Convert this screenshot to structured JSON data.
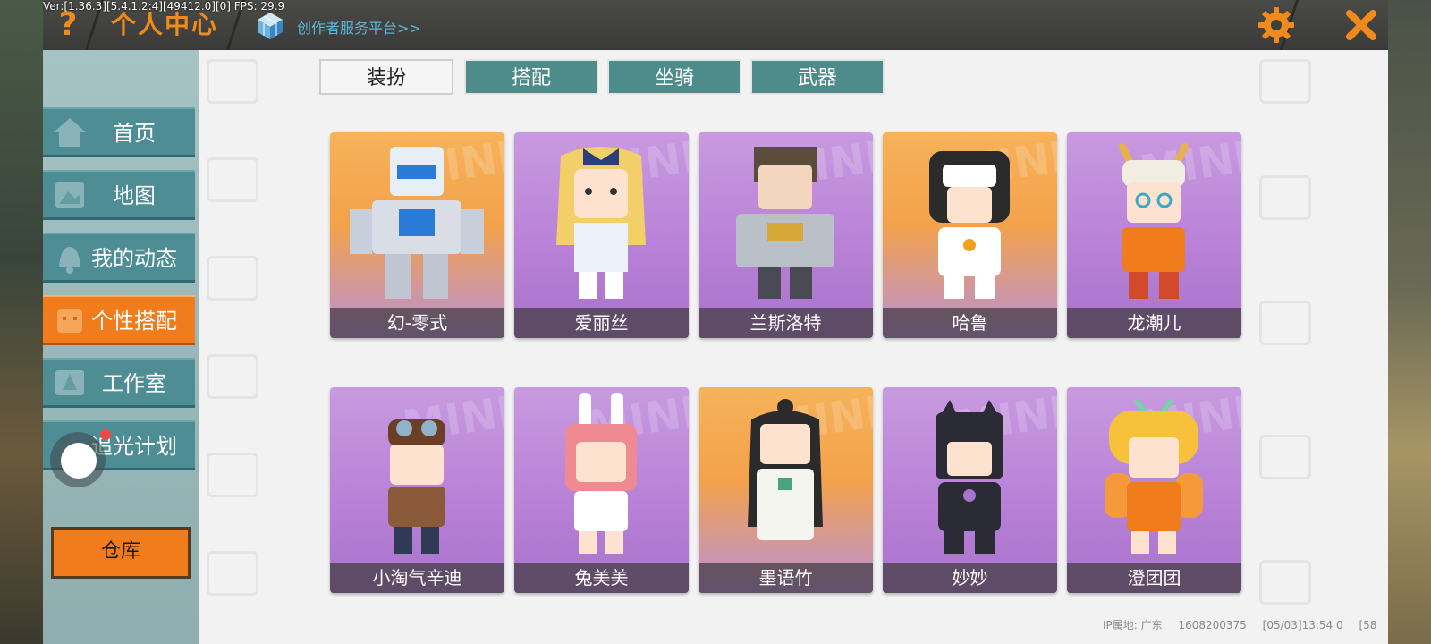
{
  "version_text": "Ver:[1.36.3][5.4.1.2:4][49412.0][0] FPS: 29.9",
  "header": {
    "title": "个人中心",
    "creator_link": "创作者服务平台>>"
  },
  "sidebar": {
    "items": [
      {
        "label": "首页",
        "active": false
      },
      {
        "label": "地图",
        "active": false
      },
      {
        "label": "我的动态",
        "active": false
      },
      {
        "label": "个性搭配",
        "active": true
      },
      {
        "label": "工作室",
        "active": false
      },
      {
        "label": "追光计划",
        "active": false
      }
    ],
    "warehouse_label": "仓库"
  },
  "tabs": [
    {
      "label": "装扮",
      "active": true
    },
    {
      "label": "搭配",
      "active": false
    },
    {
      "label": "坐骑",
      "active": false
    },
    {
      "label": "武器",
      "active": false
    }
  ],
  "cards": [
    {
      "name": "幻-零式",
      "bg": "orange"
    },
    {
      "name": "爱丽丝",
      "bg": "purple"
    },
    {
      "name": "兰斯洛特",
      "bg": "purple"
    },
    {
      "name": "哈鲁",
      "bg": "orange"
    },
    {
      "name": "龙潮儿",
      "bg": "purple"
    },
    {
      "name": "小淘气辛迪",
      "bg": "purple"
    },
    {
      "name": "兔美美",
      "bg": "purple"
    },
    {
      "name": "墨语竹",
      "bg": "orange"
    },
    {
      "name": "妙妙",
      "bg": "purple"
    },
    {
      "name": "澄团团",
      "bg": "purple"
    }
  ],
  "card_watermark": "MINI",
  "footer": {
    "ip": "IP属地: 广东",
    "uid": "1608200375",
    "time": "[05/03]13:54 0",
    "extra": "[58"
  },
  "colors": {
    "accent": "#f07c1c",
    "teal": "#4f8d95",
    "link": "#5fb6d8"
  }
}
